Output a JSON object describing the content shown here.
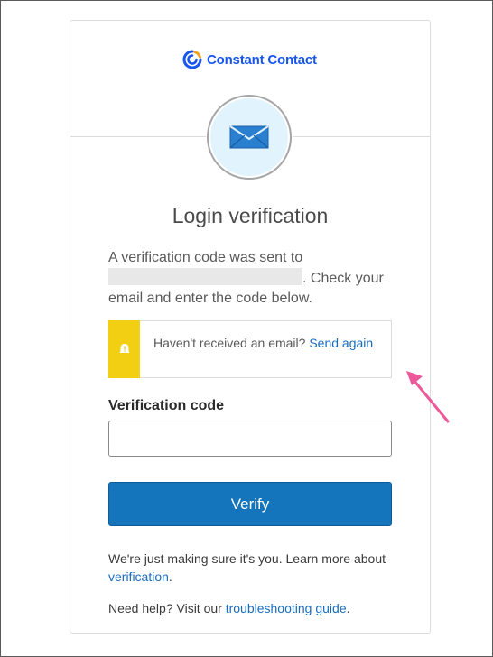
{
  "brand": {
    "name": "Constant Contact",
    "color": "#1856ed",
    "accent": "#f2a01b"
  },
  "header_icon": "envelope-icon",
  "title": "Login verification",
  "message": {
    "line_start": "A verification code was sent to",
    "line_end": ". Check your email and enter the code below."
  },
  "callout": {
    "icon": "warning-icon",
    "text": "Haven't received an email?",
    "link": "Send again",
    "bar_color": "#f2cf12"
  },
  "form": {
    "label": "Verification code",
    "value": "",
    "button": "Verify",
    "button_color": "#1575bc"
  },
  "footer": {
    "text1": "We're just making sure it's you. Learn more about",
    "link1": "verification",
    "end1": ".",
    "text2": "Need help? Visit our",
    "link2": "troubleshooting guide",
    "end2": "."
  },
  "annotation": {
    "arrow_color": "#ec5a9b"
  }
}
